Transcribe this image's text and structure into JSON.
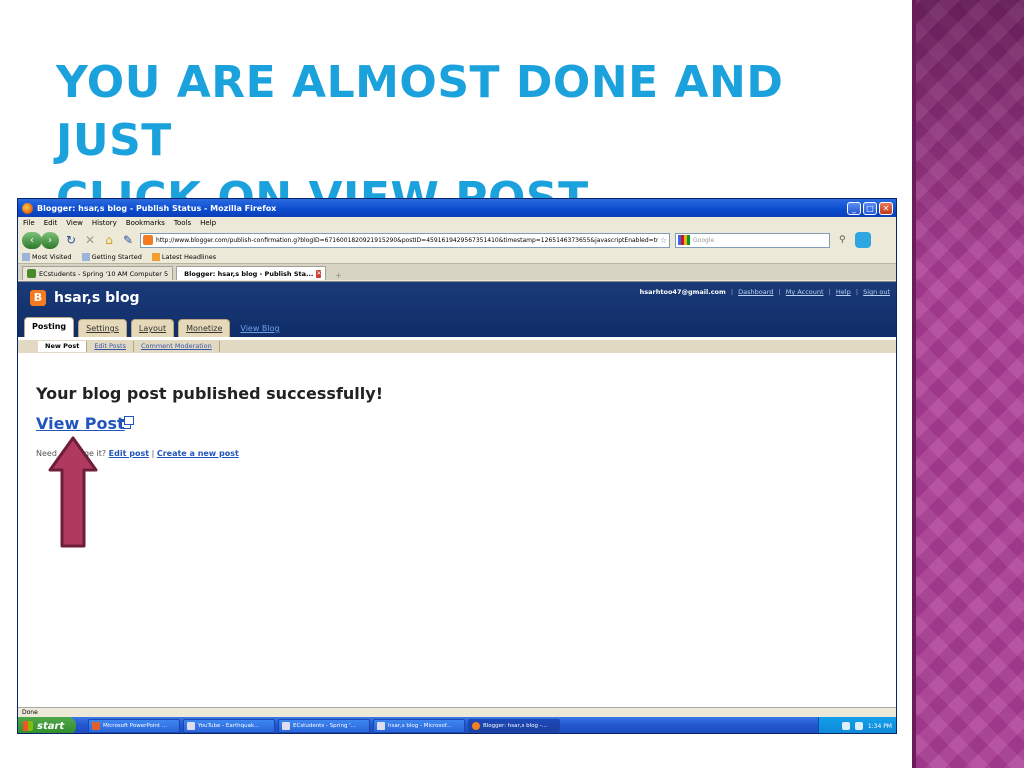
{
  "slide": {
    "title_line1": "YOU ARE ALMOST DONE AND JUST",
    "title_line2": "CLICK ON VIEW POST."
  },
  "browser": {
    "window_title": "Blogger: hsar,s blog - Publish Status - Mozilla Firefox",
    "menu": [
      "File",
      "Edit",
      "View",
      "History",
      "Bookmarks",
      "Tools",
      "Help"
    ],
    "url": "http://www.blogger.com/publish-confirmation.g?blogID=6716001820921915290&postID=4591619429567351410&timestamp=1265146373655&javascriptEnabled=true",
    "search_placeholder": "Google",
    "bookmarks": [
      "Most Visited",
      "Getting Started",
      "Latest Headlines"
    ],
    "tabs": [
      {
        "label": "ECstudents - Spring '10 AM Computer 5"
      },
      {
        "label": "Blogger: hsar,s blog - Publish Sta..."
      }
    ],
    "status": "Done"
  },
  "blogger": {
    "blog_name": "hsar,s blog",
    "email": "hsarhtoo47@gmail.com",
    "links": {
      "dashboard": "Dashboard",
      "my_account": "My Account",
      "help": "Help",
      "sign_out": "Sign out"
    },
    "tabs": {
      "posting": "Posting",
      "settings": "Settings",
      "layout": "Layout",
      "monetize": "Monetize",
      "view_blog": "View Blog"
    },
    "subtabs": {
      "new_post": "New Post",
      "edit_posts": "Edit Posts",
      "comment_moderation": "Comment Moderation"
    },
    "message": "Your blog post published successfully!",
    "view_post": "View Post",
    "need_prefix": "Need",
    "need_middle": "nge it?",
    "edit_post": "Edit post",
    "separator": "|",
    "create_new_post": "Create a new post"
  },
  "taskbar": {
    "start": "start",
    "items": [
      "Microsoft PowerPoint ...",
      "YouTube - Earthquak...",
      "ECstudents - Spring '...",
      "hsar,s blog - Microsof...",
      "Blogger: hsar,s blog -..."
    ],
    "time": "1:34 PM"
  },
  "colors": {
    "title": "#1ba1dc",
    "arrow": "#b03a5e",
    "blogger_header": "#0f2d68"
  }
}
